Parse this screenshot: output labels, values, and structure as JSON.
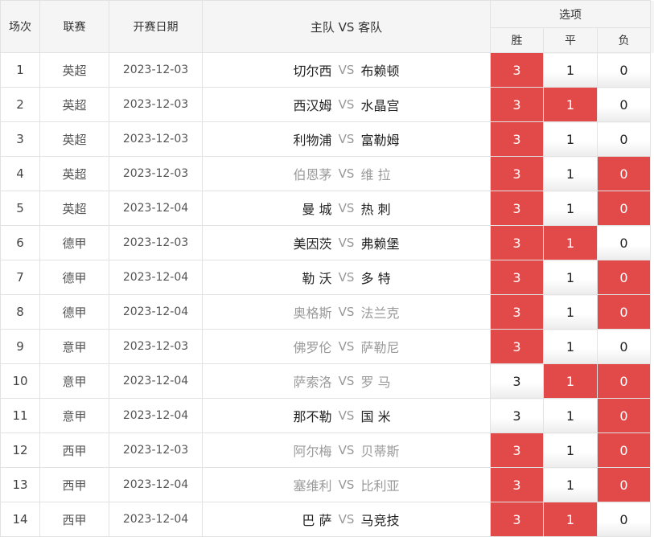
{
  "header": {
    "index": "场次",
    "league": "联赛",
    "date": "开赛日期",
    "match": "主队 VS 客队",
    "options": "选项",
    "win": "胜",
    "draw": "平",
    "lose": "负"
  },
  "colors": {
    "selected": "#e24a4a",
    "header_bg": "#f5f5f5",
    "border": "#e2e2e2"
  },
  "rows": [
    {
      "idx": "1",
      "league": "英超",
      "date": "2023-12-03",
      "home": "切尔西",
      "vs": "VS",
      "away": "布赖顿",
      "tone": "dark",
      "win": "3",
      "draw": "1",
      "lose": "0",
      "sel": [
        true,
        false,
        false
      ]
    },
    {
      "idx": "2",
      "league": "英超",
      "date": "2023-12-03",
      "home": "西汉姆",
      "vs": "VS",
      "away": "水晶宫",
      "tone": "dark",
      "win": "3",
      "draw": "1",
      "lose": "0",
      "sel": [
        true,
        true,
        false
      ]
    },
    {
      "idx": "3",
      "league": "英超",
      "date": "2023-12-03",
      "home": "利物浦",
      "vs": "VS",
      "away": "富勒姆",
      "tone": "dark",
      "win": "3",
      "draw": "1",
      "lose": "0",
      "sel": [
        true,
        false,
        false
      ]
    },
    {
      "idx": "4",
      "league": "英超",
      "date": "2023-12-03",
      "home": "伯恩茅",
      "vs": "VS",
      "away": "维 拉",
      "tone": "gray",
      "win": "3",
      "draw": "1",
      "lose": "0",
      "sel": [
        true,
        false,
        true
      ]
    },
    {
      "idx": "5",
      "league": "英超",
      "date": "2023-12-04",
      "home": "曼 城",
      "vs": "VS",
      "away": "热 刺",
      "tone": "dark",
      "win": "3",
      "draw": "1",
      "lose": "0",
      "sel": [
        true,
        false,
        true
      ]
    },
    {
      "idx": "6",
      "league": "德甲",
      "date": "2023-12-03",
      "home": "美因茨",
      "vs": "VS",
      "away": "弗赖堡",
      "tone": "dark",
      "win": "3",
      "draw": "1",
      "lose": "0",
      "sel": [
        true,
        true,
        false
      ]
    },
    {
      "idx": "7",
      "league": "德甲",
      "date": "2023-12-04",
      "home": "勒 沃",
      "vs": "VS",
      "away": "多 特",
      "tone": "dark",
      "win": "3",
      "draw": "1",
      "lose": "0",
      "sel": [
        true,
        false,
        true
      ]
    },
    {
      "idx": "8",
      "league": "德甲",
      "date": "2023-12-04",
      "home": "奥格斯",
      "vs": "VS",
      "away": "法兰克",
      "tone": "gray",
      "win": "3",
      "draw": "1",
      "lose": "0",
      "sel": [
        true,
        false,
        true
      ]
    },
    {
      "idx": "9",
      "league": "意甲",
      "date": "2023-12-03",
      "home": "佛罗伦",
      "vs": "VS",
      "away": "萨勒尼",
      "tone": "gray",
      "win": "3",
      "draw": "1",
      "lose": "0",
      "sel": [
        true,
        false,
        false
      ]
    },
    {
      "idx": "10",
      "league": "意甲",
      "date": "2023-12-04",
      "home": "萨索洛",
      "vs": "VS",
      "away": "罗 马",
      "tone": "gray",
      "win": "3",
      "draw": "1",
      "lose": "0",
      "sel": [
        false,
        true,
        true
      ]
    },
    {
      "idx": "11",
      "league": "意甲",
      "date": "2023-12-04",
      "home": "那不勒",
      "vs": "VS",
      "away": "国 米",
      "tone": "dark",
      "win": "3",
      "draw": "1",
      "lose": "0",
      "sel": [
        false,
        false,
        true
      ]
    },
    {
      "idx": "12",
      "league": "西甲",
      "date": "2023-12-03",
      "home": "阿尔梅",
      "vs": "VS",
      "away": "贝蒂斯",
      "tone": "gray",
      "win": "3",
      "draw": "1",
      "lose": "0",
      "sel": [
        true,
        false,
        true
      ]
    },
    {
      "idx": "13",
      "league": "西甲",
      "date": "2023-12-04",
      "home": "塞维利",
      "vs": "VS",
      "away": "比利亚",
      "tone": "gray",
      "win": "3",
      "draw": "1",
      "lose": "0",
      "sel": [
        true,
        false,
        true
      ]
    },
    {
      "idx": "14",
      "league": "西甲",
      "date": "2023-12-04",
      "home": "巴 萨",
      "vs": "VS",
      "away": "马竞技",
      "tone": "dark",
      "win": "3",
      "draw": "1",
      "lose": "0",
      "sel": [
        true,
        true,
        false
      ]
    }
  ]
}
